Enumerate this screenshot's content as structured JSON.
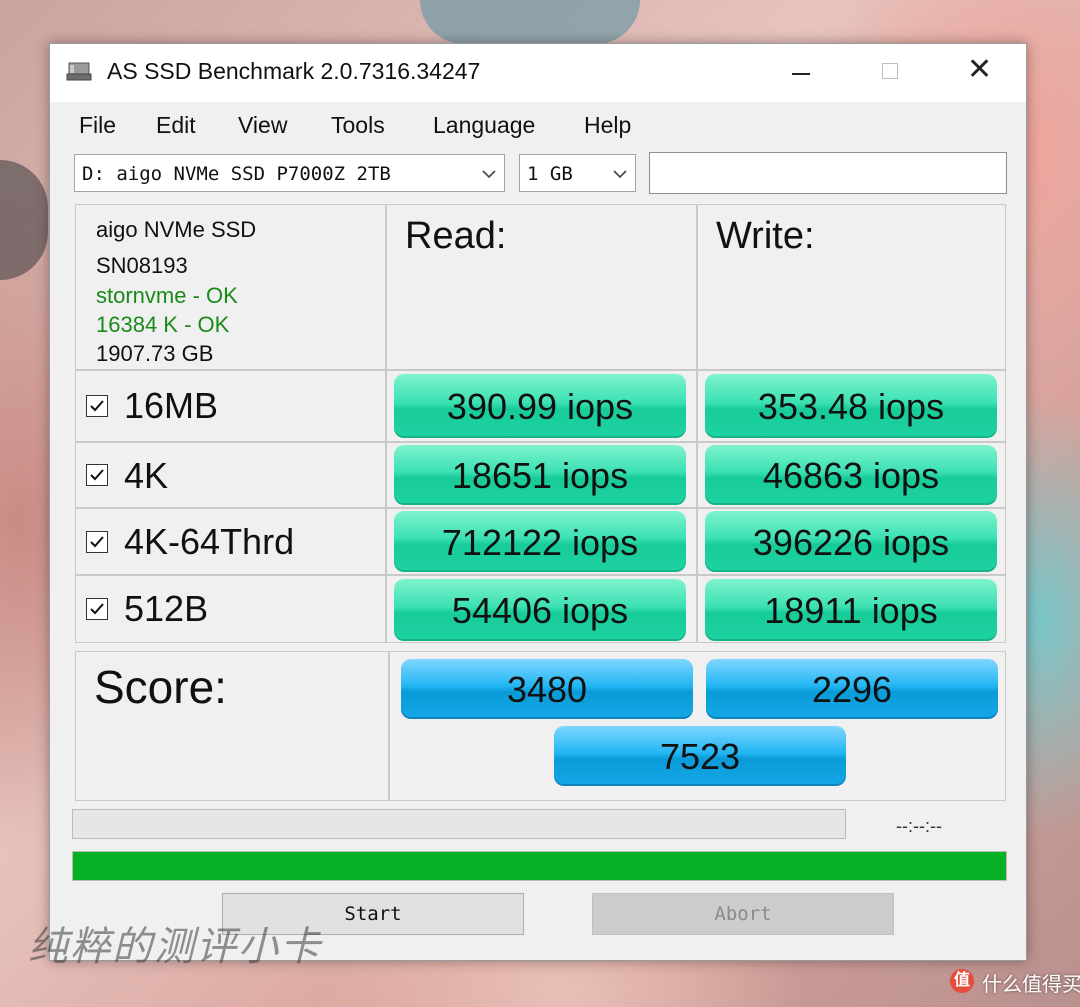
{
  "window": {
    "title": "AS SSD Benchmark 2.0.7316.34247",
    "close_glyph": "✕"
  },
  "menu": [
    "File",
    "Edit",
    "View",
    "Tools",
    "Language",
    "Help"
  ],
  "drive_select": {
    "value": "D: aigo NVMe SSD P7000Z 2TB"
  },
  "size_select": {
    "value": "1 GB"
  },
  "text_field": {
    "value": ""
  },
  "drive_info": {
    "model": "aigo NVMe SSD",
    "firmware": "SN08193",
    "driver_status": "stornvme - OK",
    "alignment_status": "16384 K - OK",
    "capacity": "1907.73 GB",
    "ok_color": "#1a8a1a"
  },
  "headers": {
    "read": "Read:",
    "write": "Write:"
  },
  "tests": [
    {
      "label": "16MB",
      "checked": true,
      "read": "390.99 iops",
      "write": "353.48 iops"
    },
    {
      "label": "4K",
      "checked": true,
      "read": "18651 iops",
      "write": "46863 iops"
    },
    {
      "label": "4K-64Thrd",
      "checked": true,
      "read": "712122 iops",
      "write": "396226 iops"
    },
    {
      "label": "512B",
      "checked": true,
      "read": "54406 iops",
      "write": "18911 iops"
    }
  ],
  "score": {
    "label": "Score:",
    "read": "3480",
    "write": "2296",
    "total": "7523"
  },
  "progress": {
    "time_text": "--:--:--",
    "top_fraction": 0,
    "bottom_fraction": 1.0,
    "fill_color": "#06b025"
  },
  "buttons": {
    "start": "Start",
    "abort": "Abort"
  },
  "icons": {
    "app": "drive-icon",
    "checkbox": "checkmark-icon",
    "dropdown": "chevron-down-icon"
  },
  "overlay": {
    "watermark": "纯粹的测评小卡",
    "site_badge": "值",
    "site_name": "什么值得买"
  }
}
